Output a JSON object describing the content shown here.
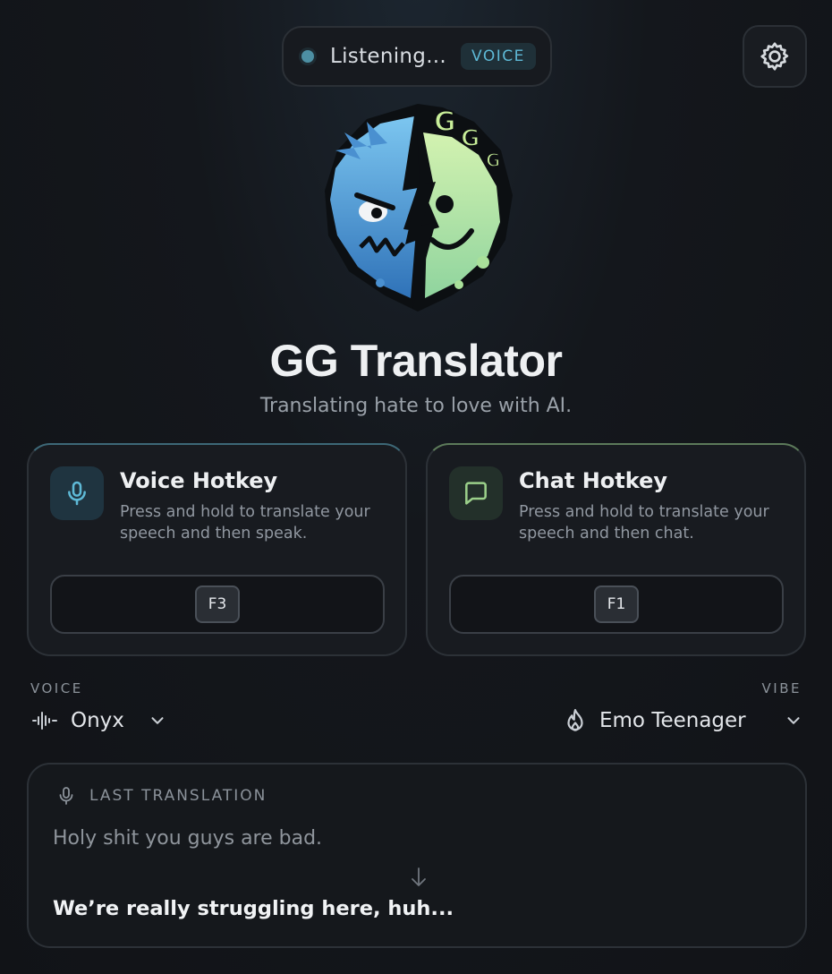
{
  "status": {
    "text": "Listening...",
    "mode": "VOICE"
  },
  "app": {
    "title": "GG Translator",
    "subtitle": "Translating hate to love with AI."
  },
  "logo": {
    "lettering": "GGG"
  },
  "cards": {
    "voice": {
      "title": "Voice Hotkey",
      "description": "Press and hold to translate your speech and then speak.",
      "key": "F3"
    },
    "chat": {
      "title": "Chat Hotkey",
      "description": "Press and hold to translate your speech and then chat.",
      "key": "F1"
    }
  },
  "voice_select": {
    "label": "VOICE",
    "value": "Onyx"
  },
  "vibe_select": {
    "label": "VIBE",
    "value": "Emo Teenager"
  },
  "last_translation": {
    "label": "LAST TRANSLATION",
    "original": "Holy shit you guys are bad.",
    "translated": "We’re really struggling here, huh..."
  },
  "colors": {
    "accent_voice": "#5eb9d6",
    "accent_chat": "#9bd08a",
    "background": "#14171c"
  }
}
